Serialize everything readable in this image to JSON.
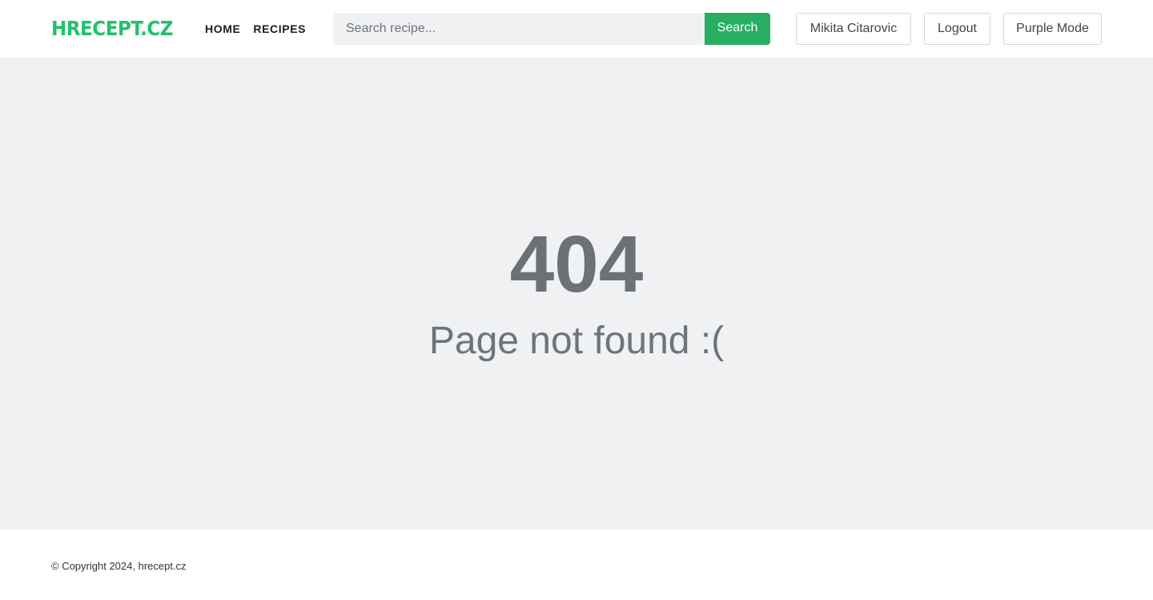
{
  "header": {
    "logo": "HRECEPT.CZ",
    "nav": [
      {
        "label": "HOME"
      },
      {
        "label": "RECIPES"
      }
    ],
    "search": {
      "placeholder": "Search recipe...",
      "value": "",
      "button_label": "Search"
    },
    "user_button": "Mikita Citarovic",
    "logout_button": "Logout",
    "mode_button": "Purple Mode"
  },
  "main": {
    "code": "404",
    "message": "Page not found :("
  },
  "footer": {
    "copyright": "© Copyright 2024, hrecept.cz"
  },
  "colors": {
    "brand_green": "#22c16b",
    "search_button": "#27ae60",
    "page_background": "#f0f1f3",
    "error_text": "#6b7177"
  }
}
